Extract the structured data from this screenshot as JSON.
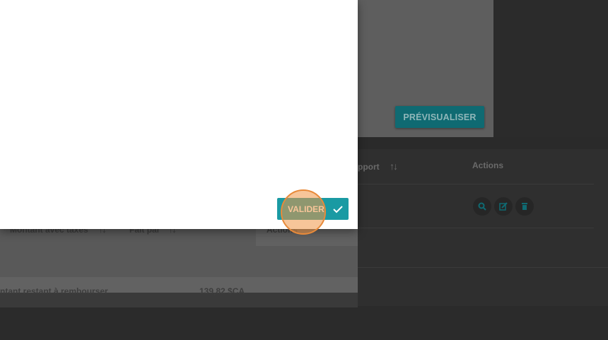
{
  "background": {
    "preview_button": "PRÉVISUALISER",
    "table": {
      "col_rapport": "pport",
      "col_actions": "Actions"
    }
  },
  "under_modal": {
    "col_montant": "Montant avec taxes",
    "col_fait_par": "Fait par",
    "col_actions": "Actions",
    "remaining_label": "ntant restant à rembourser",
    "remaining_value": "139,82 $CA"
  },
  "modal": {
    "valider_label": "VALIDER"
  },
  "colors": {
    "accent": "#1a9aa3",
    "click_indicator": "#e88a3a"
  }
}
